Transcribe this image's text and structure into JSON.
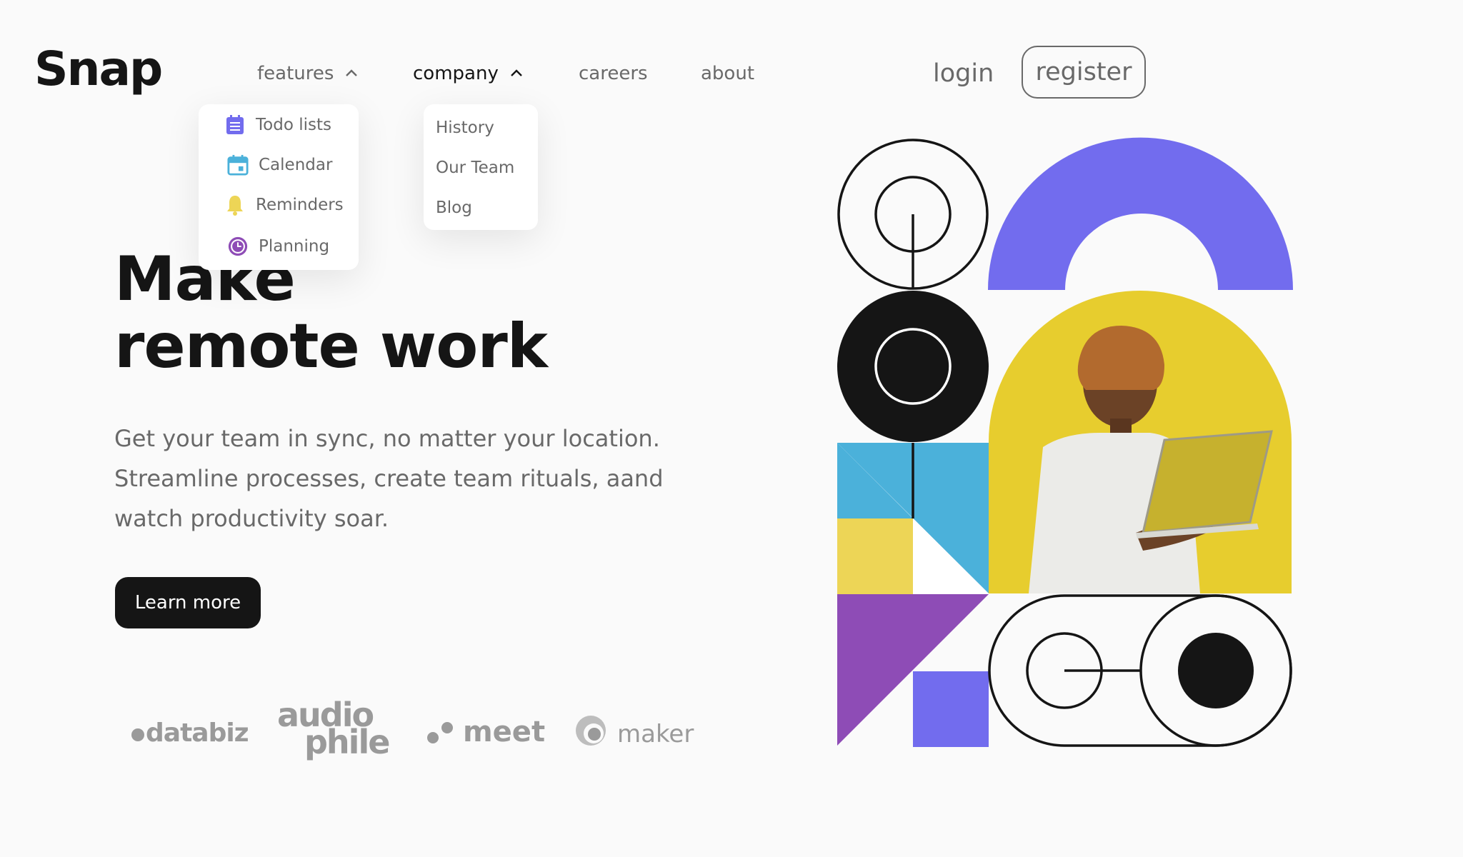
{
  "brand": {
    "logo": "Snap"
  },
  "nav": {
    "items": [
      {
        "label": "features",
        "has_dropdown": true,
        "expanded": true
      },
      {
        "label": "company",
        "has_dropdown": true,
        "expanded": true
      },
      {
        "label": "careers",
        "has_dropdown": false
      },
      {
        "label": "about",
        "has_dropdown": false
      }
    ],
    "features_menu": [
      {
        "label": "Todo lists",
        "icon": "todo-list-icon",
        "color": "#726CEE"
      },
      {
        "label": "Calendar",
        "icon": "calendar-icon",
        "color": "#4BB1DA"
      },
      {
        "label": "Reminders",
        "icon": "bell-icon",
        "color": "#EDD556"
      },
      {
        "label": "Planning",
        "icon": "clock-icon",
        "color": "#8E4CB6"
      }
    ],
    "company_menu": [
      {
        "label": "History"
      },
      {
        "label": "Our Team"
      },
      {
        "label": "Blog"
      }
    ]
  },
  "auth": {
    "login": "login",
    "register": "register"
  },
  "hero": {
    "title_lines": [
      "Make",
      "remote work"
    ],
    "description_lines": [
      "Get your team in sync, no matter your location.",
      "Streamline processes, create team rituals, aand",
      "watch productivity soar."
    ],
    "cta": "Learn more"
  },
  "clients": {
    "databiz": "databiz",
    "audiophile_lines": [
      "audio",
      "phile"
    ],
    "meet": "meet",
    "maker": "maker"
  },
  "colors": {
    "text_dark": "#151515",
    "text_gray": "#696969",
    "purple": "#726CEE",
    "blue": "#4BB1DA",
    "yellow": "#EDD556",
    "violet": "#8E4CB6",
    "photo_yellow": "#E7CD2E"
  }
}
